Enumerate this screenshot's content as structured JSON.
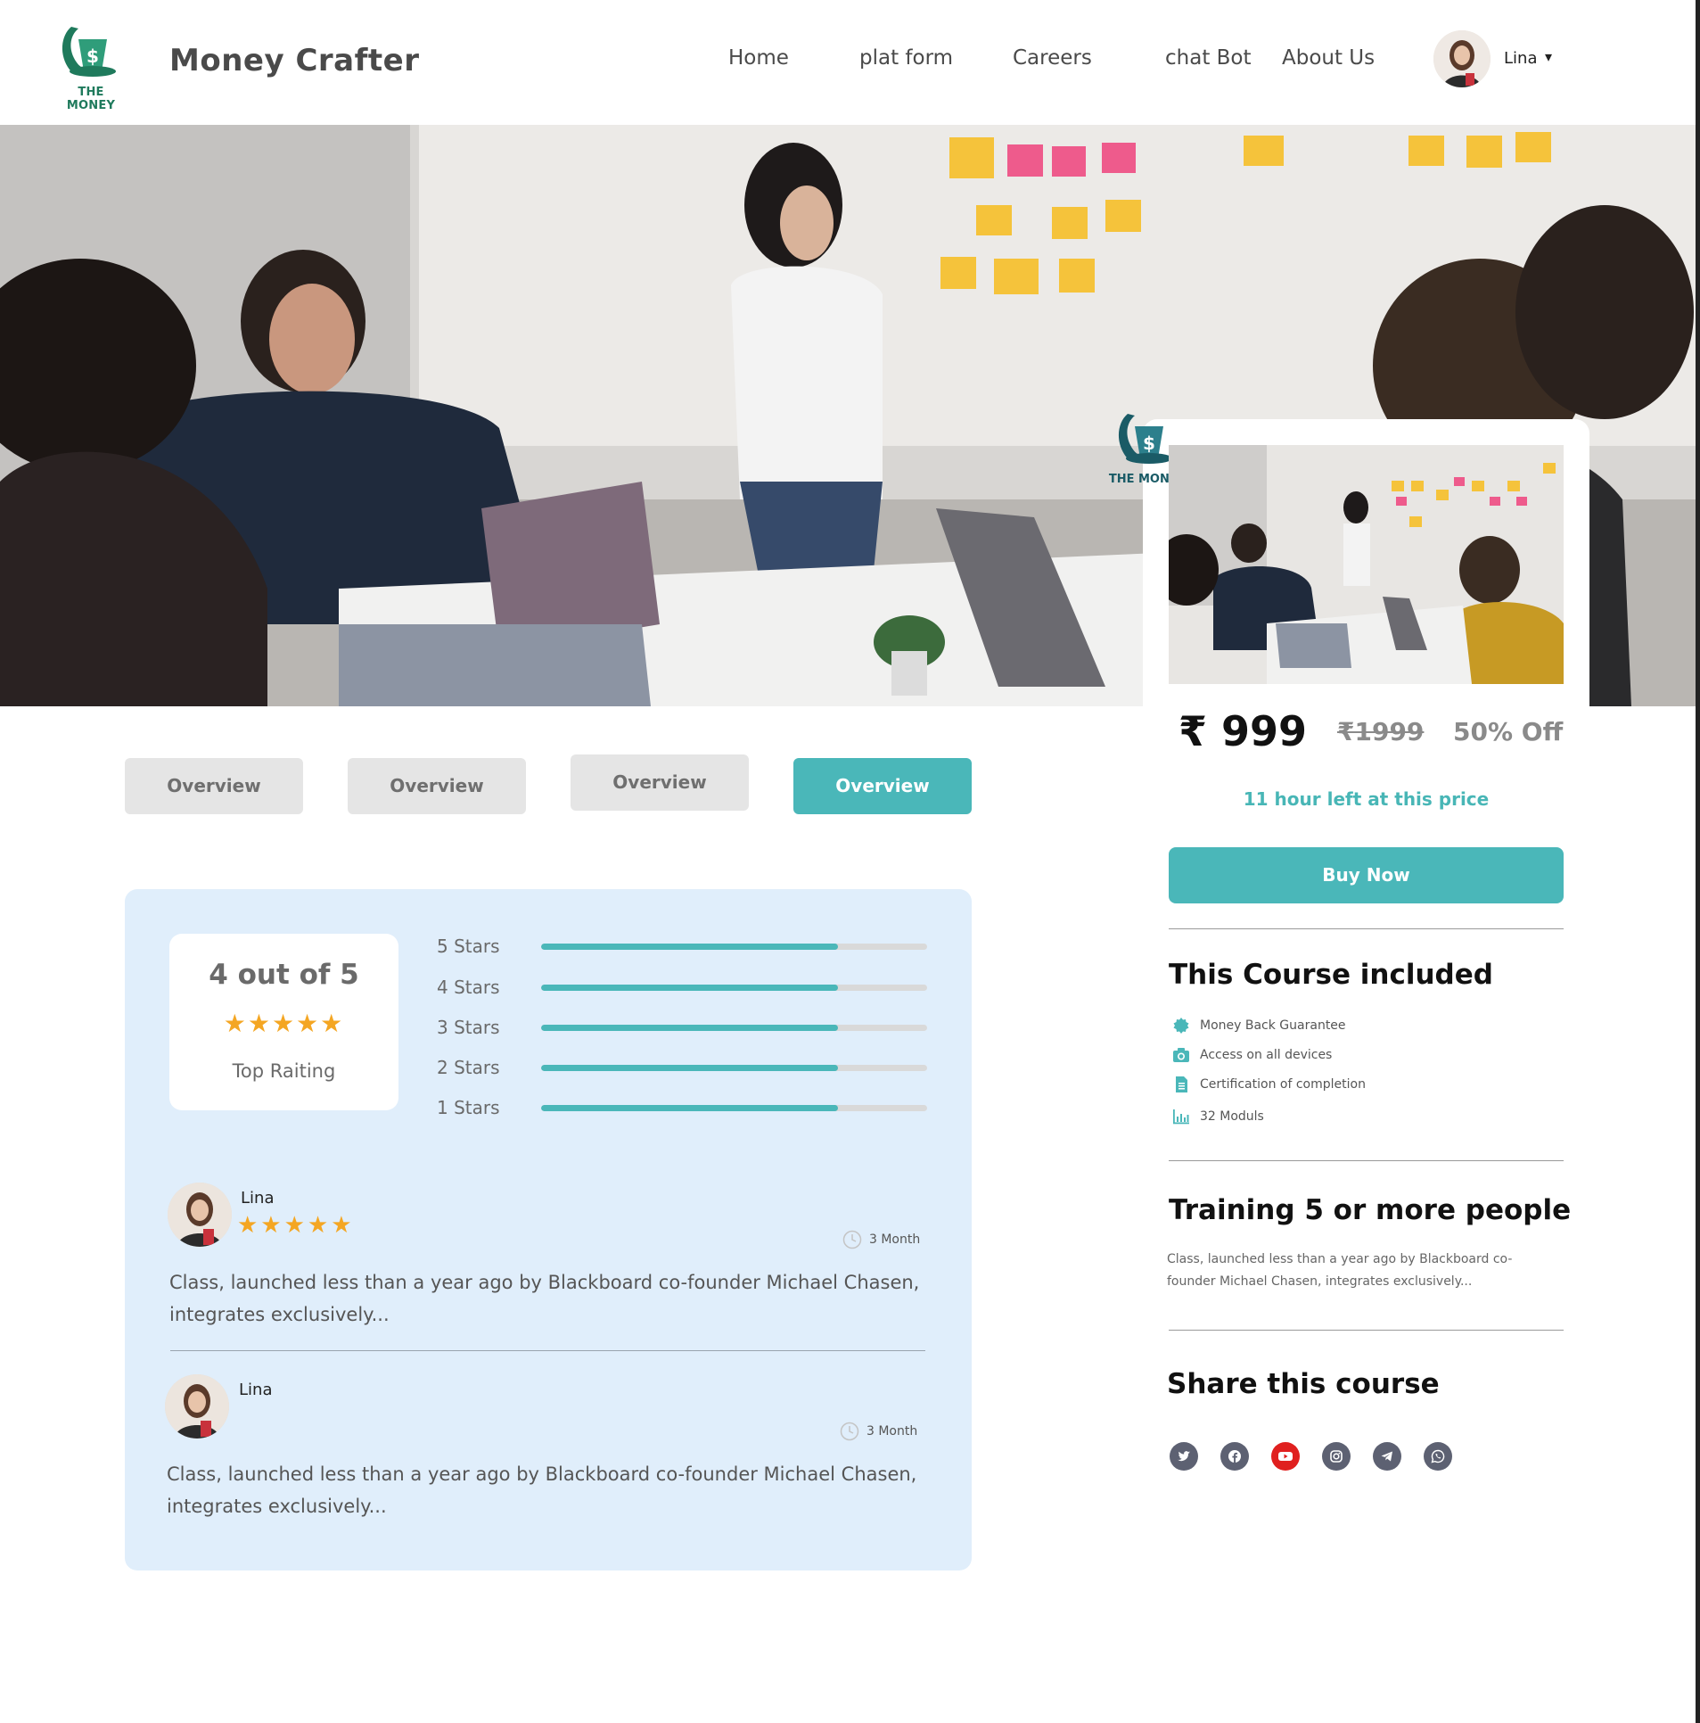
{
  "header": {
    "logo_text": "THE MONEY",
    "brand": "Money Crafter",
    "nav": [
      "Home",
      "plat form",
      "Careers",
      "chat Bot",
      "About Us"
    ],
    "user_name": "Lina"
  },
  "course_card": {
    "logo_text": "THE MONEY",
    "price": "₹ 999",
    "old_price": "₹1999",
    "discount": "50% Off",
    "time_left": "11 hour left at this price",
    "buy_label": "Buy Now",
    "included_title": "This Course included",
    "included": [
      {
        "icon": "badge-check-icon",
        "label": "Money Back Guarantee"
      },
      {
        "icon": "camera-icon",
        "label": "Access on all devices"
      },
      {
        "icon": "document-icon",
        "label": "Certification of completion"
      },
      {
        "icon": "bar-chart-icon",
        "label": "32 Moduls"
      }
    ],
    "training_title": "Training 5 or more people",
    "training_text": "Class, launched less than a year ago by Blackboard co-founder Michael Chasen, integrates exclusively...",
    "share_title": "Share this course",
    "social": [
      "twitter-icon",
      "facebook-icon",
      "youtube-icon",
      "instagram-icon",
      "telegram-icon",
      "whatsapp-icon"
    ]
  },
  "tabs": [
    "Overview",
    "Overview",
    "Overview",
    "Overview"
  ],
  "rating": {
    "score_title": "4 out of 5",
    "stars": "★★★★★",
    "subtitle": "Top Raiting",
    "bars": [
      {
        "label": "5 Stars",
        "fill": 0.77
      },
      {
        "label": "4 Stars",
        "fill": 0.77
      },
      {
        "label": "3 Stars",
        "fill": 0.77
      },
      {
        "label": "2 Stars",
        "fill": 0.77
      },
      {
        "label": "1 Stars",
        "fill": 0.77
      }
    ]
  },
  "reviews": [
    {
      "name": "Lina",
      "stars": "★★★★★",
      "time": "3 Month",
      "text": "Class, launched less than a year ago by Blackboard co-founder Michael Chasen, integrates exclusively..."
    },
    {
      "name": "Lina",
      "stars": "",
      "time": "3 Month",
      "text": "Class, launched less than a year ago by Blackboard co-founder Michael Chasen, integrates exclusively..."
    }
  ],
  "colors": {
    "accent": "#4ab7b9",
    "panel": "#e0eefb",
    "star": "#f4a623",
    "brand_green": "#1f7a5c"
  }
}
